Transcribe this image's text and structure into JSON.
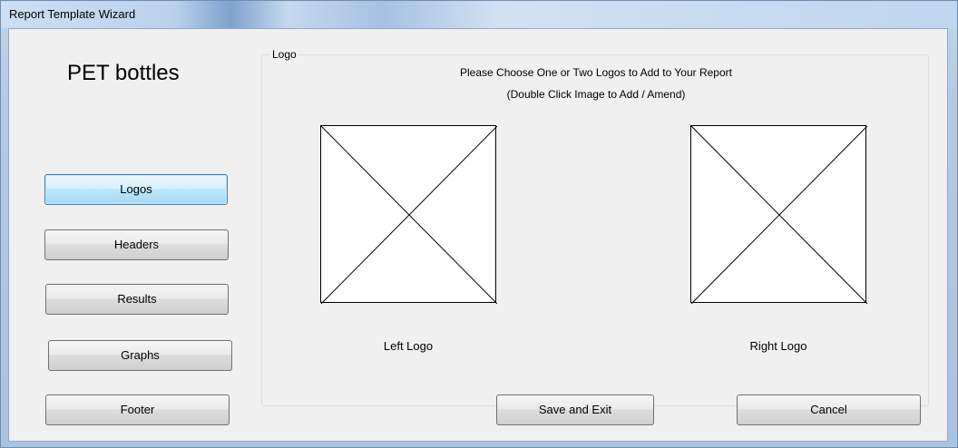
{
  "window": {
    "title": "Report Template Wizard"
  },
  "app": {
    "title": "PET bottles"
  },
  "nav": {
    "buttons": [
      {
        "label": "Logos",
        "active": true
      },
      {
        "label": "Headers",
        "active": false
      },
      {
        "label": "Results",
        "active": false
      },
      {
        "label": "Graphs",
        "active": false
      },
      {
        "label": "Footer",
        "active": false
      }
    ]
  },
  "logo_group": {
    "legend": "Logo",
    "instruction_line1": "Please Choose One or Two Logos to Add to Your Report",
    "instruction_line2": "(Double Click Image to Add / Amend)",
    "left_caption": "Left Logo",
    "right_caption": "Right Logo"
  },
  "footer": {
    "save_label": "Save and Exit",
    "cancel_label": "Cancel"
  },
  "colors": {
    "active_button": "#bee6fd",
    "window_frame": "#b9cde3",
    "client_bg": "#f0f0f0"
  }
}
